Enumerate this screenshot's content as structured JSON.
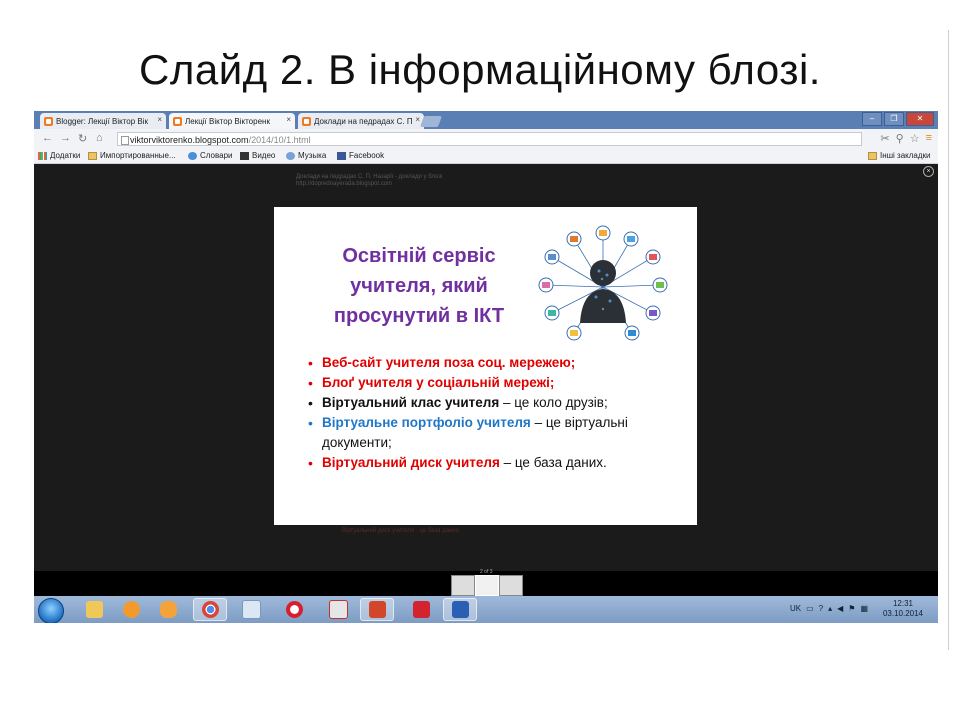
{
  "slide": {
    "title": "Слайд 2.  В інформаційному блозі."
  },
  "browser": {
    "tabs": [
      {
        "label": "Blogger: Лекції Віктор Вік",
        "active": false
      },
      {
        "label": "Лекції Віктор Вікторенк",
        "active": true
      },
      {
        "label": "Доклади на педрадах С. П",
        "active": false
      }
    ],
    "close_glyph": "×",
    "url_host": "viktorviktorenko.blogspot.com",
    "url_path": "/2014/10/1.html",
    "bookmarks": [
      {
        "label": "Додатки",
        "icon": "apps-grid-icon"
      },
      {
        "label": "Импортированные...",
        "icon": "folder-icon"
      },
      {
        "label": "Словари",
        "icon": "dictionary-icon"
      },
      {
        "label": "Видео",
        "icon": "video-icon"
      },
      {
        "label": "Музыка",
        "icon": "music-icon"
      },
      {
        "label": "Facebook",
        "icon": "facebook-icon"
      }
    ],
    "other_bookmarks": "Інші закладки"
  },
  "viewer": {
    "faint_caption_line1": "Доклади на педрадах С. П. Назарії - доклади у блозі",
    "faint_caption_line2": "http://doprednayerada.blogspot.com",
    "under_text": "Віртуальний диск учителя - це база даних.",
    "document": {
      "title": "Освітній сервіс учителя,  який просунутий  в ІКТ",
      "bullets": [
        {
          "bold": "Веб-сайт учителя поза соц. мережею;",
          "rest": "",
          "color": "red"
        },
        {
          "bold": "Блоґ учителя  у соціальній мережі;",
          "rest": "",
          "color": "red"
        },
        {
          "bold": "Віртуальний клас учителя",
          "rest": " – це коло друзів;",
          "color": "black"
        },
        {
          "bold": "Віртуальне  портфоліо учителя",
          "rest": " – це віртуальні документи;",
          "color": "blue"
        },
        {
          "bold": "Віртуальний диск учителя",
          "rest": " – це база даних.",
          "color": "red"
        }
      ]
    },
    "filmstrip_label": "2 of 3"
  },
  "taskbar": {
    "apps": [
      "explorer",
      "media-player",
      "scratch",
      "chrome",
      "notepad",
      "opera",
      "paint",
      "powerpoint",
      "codec",
      "word"
    ],
    "tray_lang": "UK",
    "time": "12:31",
    "date": "03.10.2014"
  },
  "colors": {
    "purple_title": "#7030a0",
    "red": "#e00000",
    "blue": "#1f77c8",
    "taskbar": "#8aa8cf"
  }
}
